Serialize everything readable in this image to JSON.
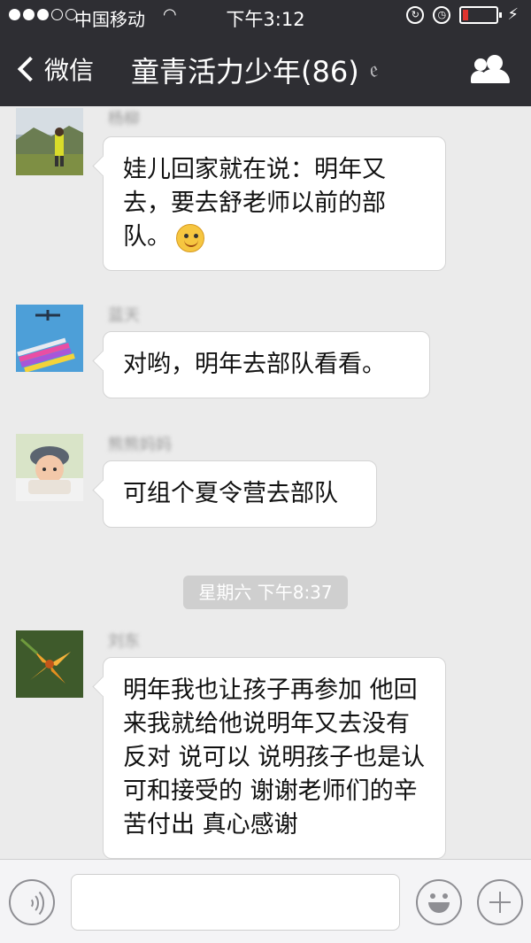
{
  "status": {
    "carrier": "中国移动",
    "time": "下午3:12"
  },
  "nav": {
    "back_label": "微信",
    "title": "童青活力少年(86)"
  },
  "messages": [
    {
      "sender": "杨柳",
      "text": "娃儿回家就在说：明年又去，要去舒老师以前的部队。",
      "has_emoji": true
    },
    {
      "sender": "蓝天",
      "text": "对哟，明年去部队看看。"
    },
    {
      "sender": "熊熊妈妈",
      "text": "可组个夏令营去部队"
    },
    {
      "sender": "刘东",
      "text": "明年我也让孩子再参加 他回来我就给他说明年又去没有反对 说可以 说明孩子也是认可和接受的 谢谢老师们的辛苦付出 真心感谢"
    }
  ],
  "timestamp": "星期六 下午8:37",
  "icons": {
    "back": "chevron-left-icon",
    "muted": "ear-muted-icon",
    "members": "group-members-icon",
    "voice": "voice-input-icon",
    "emoji": "emoji-icon",
    "more": "plus-icon"
  },
  "colors": {
    "header_bg": "#2e2e33",
    "chat_bg": "#ebebeb",
    "bubble_bg": "#ffffff",
    "timestamp_bg": "#cfcfcf"
  }
}
